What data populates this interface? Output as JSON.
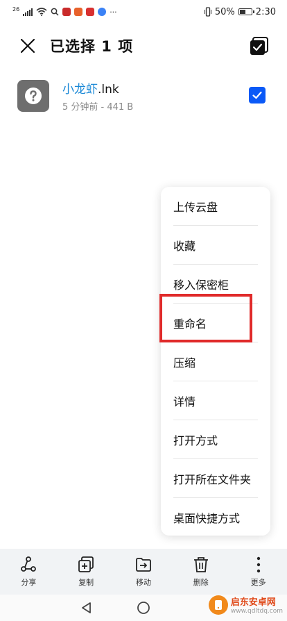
{
  "status_bar": {
    "network": "26",
    "battery_text": "50%",
    "time": "2:30",
    "more": "···"
  },
  "header": {
    "title": "已选择 1 项"
  },
  "file": {
    "name_highlight": "小龙虾",
    "name_ext": ".lnk",
    "meta": "5 分钟前 - 441 B",
    "selected": true
  },
  "menu": {
    "items": [
      {
        "label": "上传云盘"
      },
      {
        "label": "收藏"
      },
      {
        "label": "移入保密柜"
      },
      {
        "label": "重命名"
      },
      {
        "label": "压缩"
      },
      {
        "label": "详情"
      },
      {
        "label": "打开方式"
      },
      {
        "label": "打开所在文件夹"
      },
      {
        "label": "桌面快捷方式"
      }
    ]
  },
  "toolbar": {
    "items": [
      {
        "label": "分享",
        "icon": "share-icon"
      },
      {
        "label": "复制",
        "icon": "copy-icon"
      },
      {
        "label": "移动",
        "icon": "move-icon"
      },
      {
        "label": "删除",
        "icon": "trash-icon"
      },
      {
        "label": "更多",
        "icon": "more-icon"
      }
    ]
  },
  "watermark": {
    "title": "启东安卓网",
    "url": "www.qdltdq.com"
  },
  "colors": {
    "accent": "#0a59f7",
    "highlight_text": "#1a88d6",
    "annotation": "#e02a2a"
  }
}
